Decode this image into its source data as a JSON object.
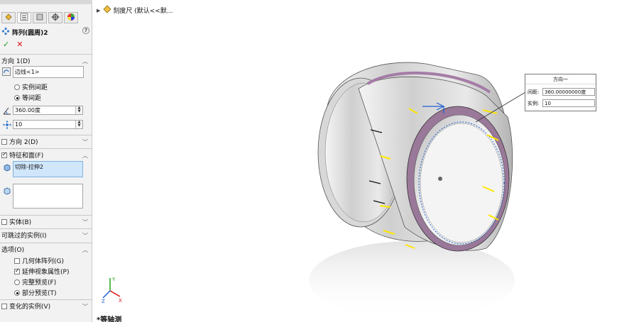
{
  "panel": {
    "feature_title": "阵列(圆周)2",
    "help_label": "?",
    "ok_label": "✓",
    "cancel_label": "✕",
    "direction1": {
      "header": "方向 1(D)",
      "edge_value": "边线<1>",
      "radio_instance_spacing": "实例间距",
      "radio_equal_spacing": "等间距",
      "angle_value": "360.00度",
      "count_value": "10"
    },
    "direction2": {
      "header": "方向 2(D)"
    },
    "features_faces": {
      "header": "特征和面(F)",
      "selected_feature": "切除-拉伸2"
    },
    "bodies": {
      "header": "实体(B)"
    },
    "skip_instances": {
      "header": "可跳过的实例(I)"
    },
    "options": {
      "header": "选项(O)",
      "geometry_pattern": "几何体阵列(G)",
      "propagate_visual": "延伸视象属性(P)",
      "full_preview": "完整预览(F)",
      "partial_preview": "部分预览(T)"
    },
    "varied_instances": {
      "header": "变化的实例(V)"
    }
  },
  "viewport": {
    "tree_label": "刻度尺 (默认<<默...",
    "view_name": "*等轴测",
    "callout": {
      "title": "方向一",
      "spacing_label": "间距:",
      "spacing_value": "360.00000000度",
      "instances_label": "实例:",
      "instances_value": "10"
    }
  },
  "colors": {
    "panel_bg": "#f2f2f2",
    "selection_bg": "#cfe6fb",
    "tick_yellow": "#ffe600",
    "ring_purple": "#a47ca6",
    "preview_blue": "#1f5fd1"
  }
}
